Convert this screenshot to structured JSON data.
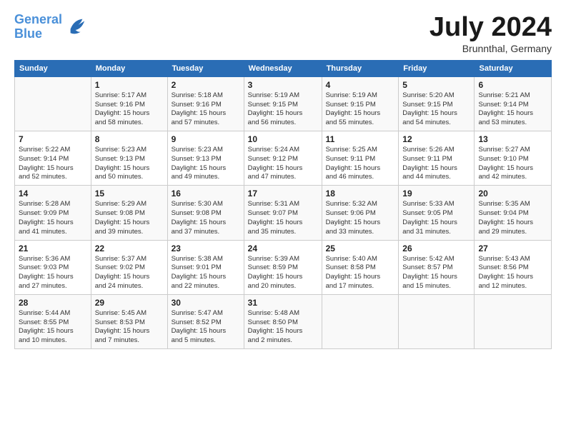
{
  "logo": {
    "line1": "General",
    "line2": "Blue"
  },
  "title": "July 2024",
  "location": "Brunnthal, Germany",
  "weekdays": [
    "Sunday",
    "Monday",
    "Tuesday",
    "Wednesday",
    "Thursday",
    "Friday",
    "Saturday"
  ],
  "weeks": [
    [
      {
        "day": "",
        "info": ""
      },
      {
        "day": "1",
        "info": "Sunrise: 5:17 AM\nSunset: 9:16 PM\nDaylight: 15 hours\nand 58 minutes."
      },
      {
        "day": "2",
        "info": "Sunrise: 5:18 AM\nSunset: 9:16 PM\nDaylight: 15 hours\nand 57 minutes."
      },
      {
        "day": "3",
        "info": "Sunrise: 5:19 AM\nSunset: 9:15 PM\nDaylight: 15 hours\nand 56 minutes."
      },
      {
        "day": "4",
        "info": "Sunrise: 5:19 AM\nSunset: 9:15 PM\nDaylight: 15 hours\nand 55 minutes."
      },
      {
        "day": "5",
        "info": "Sunrise: 5:20 AM\nSunset: 9:15 PM\nDaylight: 15 hours\nand 54 minutes."
      },
      {
        "day": "6",
        "info": "Sunrise: 5:21 AM\nSunset: 9:14 PM\nDaylight: 15 hours\nand 53 minutes."
      }
    ],
    [
      {
        "day": "7",
        "info": "Sunrise: 5:22 AM\nSunset: 9:14 PM\nDaylight: 15 hours\nand 52 minutes."
      },
      {
        "day": "8",
        "info": "Sunrise: 5:23 AM\nSunset: 9:13 PM\nDaylight: 15 hours\nand 50 minutes."
      },
      {
        "day": "9",
        "info": "Sunrise: 5:23 AM\nSunset: 9:13 PM\nDaylight: 15 hours\nand 49 minutes."
      },
      {
        "day": "10",
        "info": "Sunrise: 5:24 AM\nSunset: 9:12 PM\nDaylight: 15 hours\nand 47 minutes."
      },
      {
        "day": "11",
        "info": "Sunrise: 5:25 AM\nSunset: 9:11 PM\nDaylight: 15 hours\nand 46 minutes."
      },
      {
        "day": "12",
        "info": "Sunrise: 5:26 AM\nSunset: 9:11 PM\nDaylight: 15 hours\nand 44 minutes."
      },
      {
        "day": "13",
        "info": "Sunrise: 5:27 AM\nSunset: 9:10 PM\nDaylight: 15 hours\nand 42 minutes."
      }
    ],
    [
      {
        "day": "14",
        "info": "Sunrise: 5:28 AM\nSunset: 9:09 PM\nDaylight: 15 hours\nand 41 minutes."
      },
      {
        "day": "15",
        "info": "Sunrise: 5:29 AM\nSunset: 9:08 PM\nDaylight: 15 hours\nand 39 minutes."
      },
      {
        "day": "16",
        "info": "Sunrise: 5:30 AM\nSunset: 9:08 PM\nDaylight: 15 hours\nand 37 minutes."
      },
      {
        "day": "17",
        "info": "Sunrise: 5:31 AM\nSunset: 9:07 PM\nDaylight: 15 hours\nand 35 minutes."
      },
      {
        "day": "18",
        "info": "Sunrise: 5:32 AM\nSunset: 9:06 PM\nDaylight: 15 hours\nand 33 minutes."
      },
      {
        "day": "19",
        "info": "Sunrise: 5:33 AM\nSunset: 9:05 PM\nDaylight: 15 hours\nand 31 minutes."
      },
      {
        "day": "20",
        "info": "Sunrise: 5:35 AM\nSunset: 9:04 PM\nDaylight: 15 hours\nand 29 minutes."
      }
    ],
    [
      {
        "day": "21",
        "info": "Sunrise: 5:36 AM\nSunset: 9:03 PM\nDaylight: 15 hours\nand 27 minutes."
      },
      {
        "day": "22",
        "info": "Sunrise: 5:37 AM\nSunset: 9:02 PM\nDaylight: 15 hours\nand 24 minutes."
      },
      {
        "day": "23",
        "info": "Sunrise: 5:38 AM\nSunset: 9:01 PM\nDaylight: 15 hours\nand 22 minutes."
      },
      {
        "day": "24",
        "info": "Sunrise: 5:39 AM\nSunset: 8:59 PM\nDaylight: 15 hours\nand 20 minutes."
      },
      {
        "day": "25",
        "info": "Sunrise: 5:40 AM\nSunset: 8:58 PM\nDaylight: 15 hours\nand 17 minutes."
      },
      {
        "day": "26",
        "info": "Sunrise: 5:42 AM\nSunset: 8:57 PM\nDaylight: 15 hours\nand 15 minutes."
      },
      {
        "day": "27",
        "info": "Sunrise: 5:43 AM\nSunset: 8:56 PM\nDaylight: 15 hours\nand 12 minutes."
      }
    ],
    [
      {
        "day": "28",
        "info": "Sunrise: 5:44 AM\nSunset: 8:55 PM\nDaylight: 15 hours\nand 10 minutes."
      },
      {
        "day": "29",
        "info": "Sunrise: 5:45 AM\nSunset: 8:53 PM\nDaylight: 15 hours\nand 7 minutes."
      },
      {
        "day": "30",
        "info": "Sunrise: 5:47 AM\nSunset: 8:52 PM\nDaylight: 15 hours\nand 5 minutes."
      },
      {
        "day": "31",
        "info": "Sunrise: 5:48 AM\nSunset: 8:50 PM\nDaylight: 15 hours\nand 2 minutes."
      },
      {
        "day": "",
        "info": ""
      },
      {
        "day": "",
        "info": ""
      },
      {
        "day": "",
        "info": ""
      }
    ]
  ]
}
